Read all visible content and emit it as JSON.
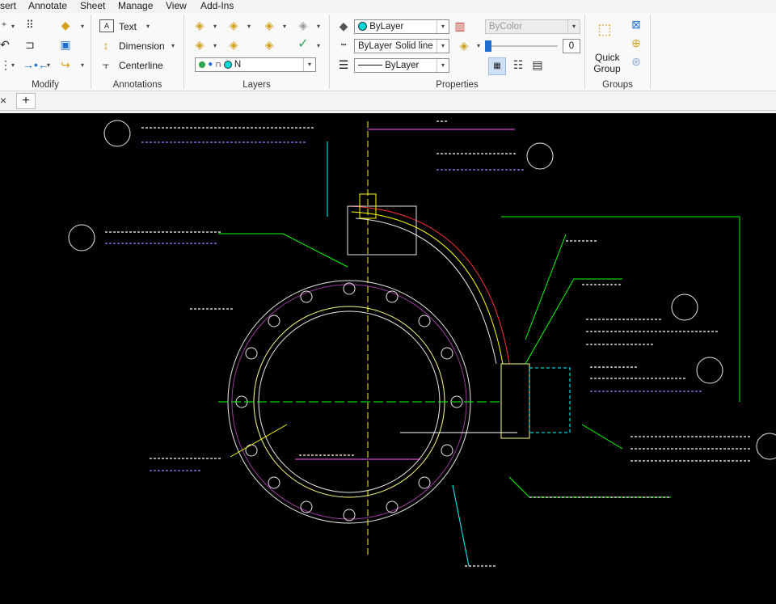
{
  "menu": [
    "sert",
    "Annotate",
    "Sheet",
    "Manage",
    "View",
    "Add-Ins"
  ],
  "panels": {
    "modify": "Modify",
    "annotations": "Annotations",
    "layers": "Layers",
    "properties": "Properties",
    "groups": "Groups"
  },
  "annotations": {
    "text": "Text",
    "dimension": "Dimension",
    "centerline": "Centerline"
  },
  "layers": {
    "current_layer": "N"
  },
  "properties": {
    "color": "ByLayer",
    "linetype": "ByLayer",
    "linetype_name": "Solid line",
    "lineweight": "ByLayer",
    "plot_style": "ByColor",
    "transparency": "0"
  },
  "groups": {
    "quick_group_line1": "Quick",
    "quick_group_line2": "Group"
  },
  "tabs": {
    "close_glyph": "×",
    "new_tab_glyph": "+"
  },
  "colors": {
    "ribbon_bg": "#f9f9f9",
    "canvas_bg": "#000000",
    "layer_bulb": "#2ea44f",
    "color_swatch": "#00d9d9"
  },
  "icons": {
    "layer_state": [
      "light-bulb-icon",
      "freeze-icon",
      "lock-icon",
      "color-swatch-icon"
    ]
  }
}
